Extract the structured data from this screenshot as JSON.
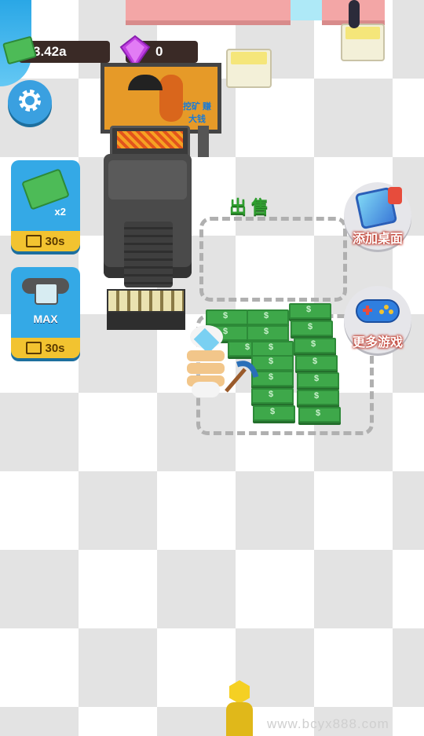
{
  "hud": {
    "cash_value": "3.42a",
    "gems_value": "0",
    "cash_icon": "cash-icon",
    "gem_icon": "purple-gem-icon"
  },
  "buttons": {
    "settings_icon": "gear-icon",
    "double_cash": {
      "badge": "x2",
      "timer": "30s",
      "icon": "video-icon"
    },
    "upgrade_tool": {
      "badge": "MAX",
      "timer": "30s",
      "icon": "video-icon"
    },
    "add_desktop_label": "添加桌面",
    "more_games_label": "更多游戏"
  },
  "world": {
    "sell_zone_label": "出售",
    "billboard_text": "挖矿 赚大钱"
  },
  "watermark": "www.bcyx888.com",
  "colors": {
    "accent_blue": "#34a9e6",
    "timer_yellow": "#f2c330",
    "cash_green": "#3ea84a",
    "sell_green": "#2e9e2e"
  }
}
